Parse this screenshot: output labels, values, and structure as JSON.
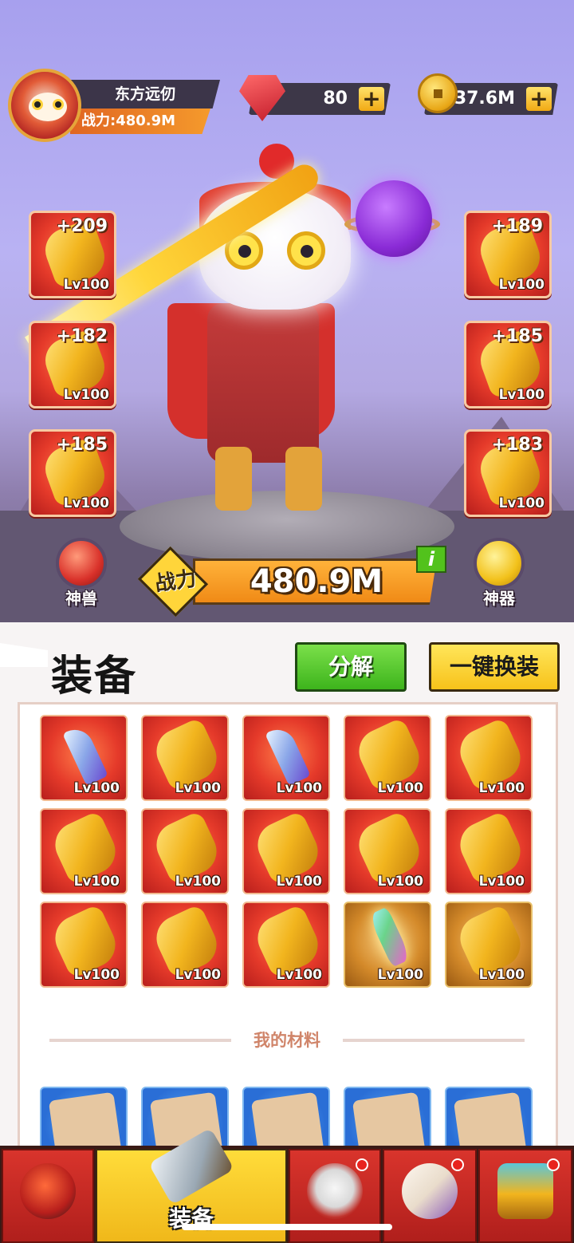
{
  "player": {
    "name": "东方远仞",
    "power_label": "战力:480.9M"
  },
  "currency": {
    "gems": {
      "value": "80",
      "icon": "ruby-gem-icon",
      "add": "+"
    },
    "gold": {
      "value": "37.6M",
      "icon": "gold-coin-icon",
      "add": "+"
    }
  },
  "equipped": {
    "left": [
      {
        "bonus": "+209",
        "level": "Lv100",
        "icon": "golden-sword-icon"
      },
      {
        "bonus": "+182",
        "level": "Lv100",
        "icon": "golden-gauntlet-icon"
      },
      {
        "bonus": "+185",
        "level": "Lv100",
        "icon": "golden-ring-icon"
      }
    ],
    "right": [
      {
        "bonus": "+189",
        "level": "Lv100",
        "icon": "golden-helmet-icon"
      },
      {
        "bonus": "+185",
        "level": "Lv100",
        "icon": "golden-armor-icon"
      },
      {
        "bonus": "+183",
        "level": "Lv100",
        "icon": "golden-amulet-icon"
      }
    ]
  },
  "power": {
    "label": "战力",
    "value": "480.9M",
    "info": "i"
  },
  "side": {
    "beast": "神兽",
    "artifact": "神器"
  },
  "panel": {
    "title": "装备",
    "decompose": "分解",
    "auto_equip": "一键换装",
    "materials_title": "我的材料"
  },
  "inventory": [
    {
      "level": "Lv100",
      "icon": "hook-blade-icon",
      "tier": "red"
    },
    {
      "level": "Lv100",
      "icon": "golden-sword-icon",
      "tier": "red"
    },
    {
      "level": "Lv100",
      "icon": "hook-blade-icon",
      "tier": "red"
    },
    {
      "level": "Lv100",
      "icon": "golden-claw-icon",
      "tier": "red"
    },
    {
      "level": "Lv100",
      "icon": "golden-sword-icon",
      "tier": "red"
    },
    {
      "level": "Lv100",
      "icon": "golden-armor-icon",
      "tier": "red"
    },
    {
      "level": "Lv100",
      "icon": "golden-helmet-icon",
      "tier": "red"
    },
    {
      "level": "Lv100",
      "icon": "golden-gauntlet-icon",
      "tier": "red"
    },
    {
      "level": "Lv100",
      "icon": "golden-gauntlet-icon",
      "tier": "red"
    },
    {
      "level": "Lv100",
      "icon": "golden-amulet-icon",
      "tier": "red"
    },
    {
      "level": "Lv100",
      "icon": "golden-amulet-icon",
      "tier": "red"
    },
    {
      "level": "Lv100",
      "icon": "golden-ring-icon",
      "tier": "red"
    },
    {
      "level": "Lv100",
      "icon": "golden-ring-icon",
      "tier": "red"
    },
    {
      "level": "Lv100",
      "icon": "rainbow-sword-icon",
      "tier": "gold"
    },
    {
      "level": "Lv100",
      "icon": "golden-boot-icon",
      "tier": "gold"
    }
  ],
  "materials": [
    "scroll-sword-icon",
    "scroll-armor-icon",
    "scroll-ring-icon",
    "scroll-gauntlet-icon",
    "scroll-boot-icon"
  ],
  "nav": {
    "active_label": "装备"
  },
  "colors": {
    "accent_orange": "#f08a16",
    "accent_gold": "#ffd53a",
    "panel_bg": "#f7f4f4",
    "item_red": "#e53a2a"
  }
}
